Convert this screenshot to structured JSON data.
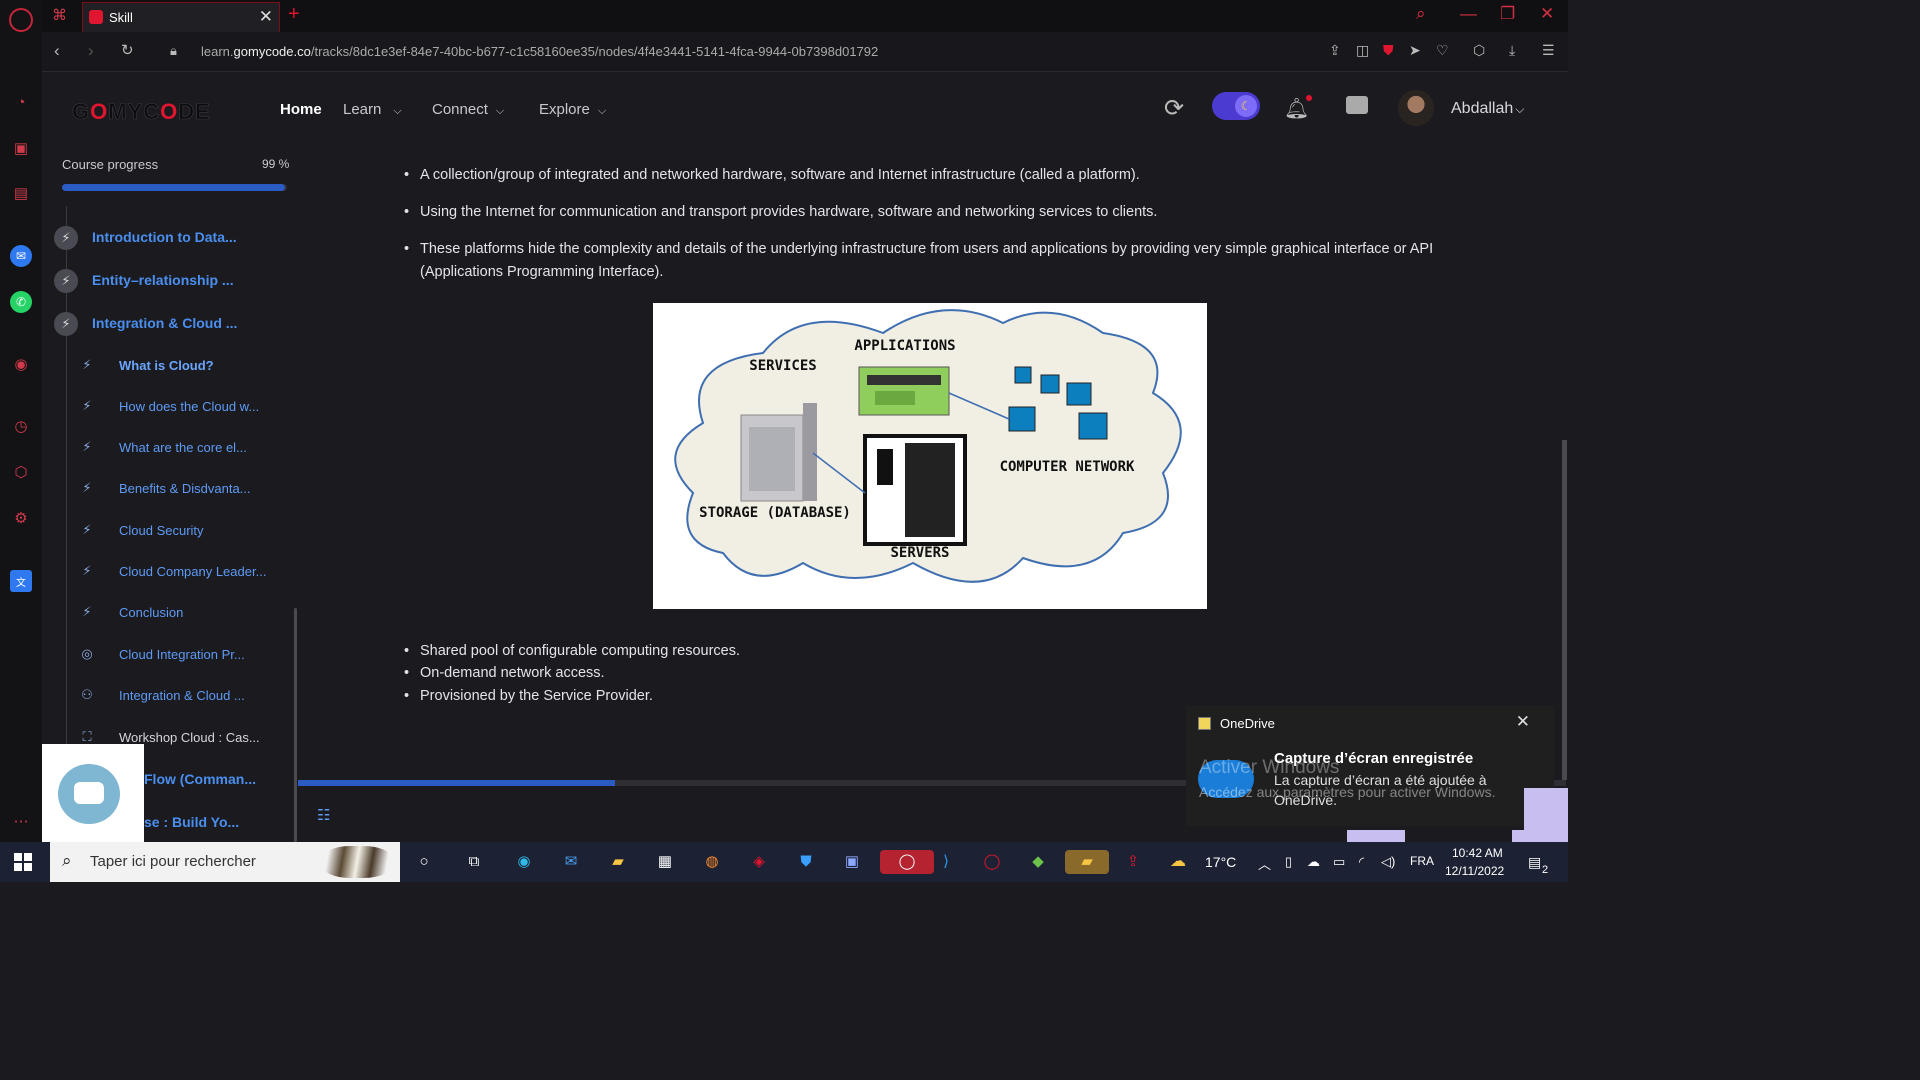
{
  "browser": {
    "tab_title": "Skill",
    "url_prefix": "learn.",
    "url_domain": "gomycode.co",
    "url_path": "/tracks/8dc1e3ef-84e7-40bc-b677-c1c58160ee35/nodes/4f4e3441-5141-4fca-9944-0b7398d01792"
  },
  "site": {
    "logo": "GOMYCODE",
    "nav": [
      {
        "label": "Home",
        "active": true
      },
      {
        "label": "Learn"
      },
      {
        "label": "Connect"
      },
      {
        "label": "Explore"
      }
    ],
    "username": "Abdallah"
  },
  "course": {
    "progress_label": "Course progress",
    "progress_value": "99 %",
    "progress_fraction": 0.99,
    "chapters": [
      {
        "label": "Introduction to Data..."
      },
      {
        "label": "Entity–relationship ..."
      },
      {
        "label": "Integration & Cloud ..."
      }
    ],
    "lessons": [
      {
        "label": "What is Cloud?",
        "icon": "bolt-icon"
      },
      {
        "label": "How does the Cloud w...",
        "icon": "bolt-icon"
      },
      {
        "label": "What are the core el...",
        "icon": "bolt-icon"
      },
      {
        "label": "Benefits & Disdvanta...",
        "icon": "bolt-icon"
      },
      {
        "label": "Cloud Security",
        "icon": "bolt-icon"
      },
      {
        "label": "Cloud Company Leader...",
        "icon": "bolt-icon"
      },
      {
        "label": "Conclusion",
        "icon": "bolt-icon"
      },
      {
        "label": "Cloud Integration Pr...",
        "icon": "target-icon"
      },
      {
        "label": "Integration & Cloud ...",
        "icon": "people-icon"
      },
      {
        "label": "Workshop Cloud : Cas...",
        "icon": "workshop-icon"
      }
    ],
    "more_chapters": [
      {
        "label": "Flow (Comman..."
      },
      {
        "label": "se : Build Yo..."
      }
    ]
  },
  "content": {
    "bullets_top": [
      "A collection/group of integrated and networked hardware, software and Internet infrastructure (called a platform).",
      "Using the Internet for communication and transport provides hardware, software and networking services to clients.",
      "These platforms hide the complexity and details of the underlying infrastructure from users and applications by providing very simple graphical interface or API (Applications Programming Interface)."
    ],
    "diagram_labels": {
      "applications": "APPLICATIONS",
      "services": "SERVICES",
      "network": "COMPUTER NETWORK",
      "storage": "STORAGE (DATABASE)",
      "servers": "SERVERS"
    },
    "bullets_bottom": [
      "Shared pool of configurable computing resources.",
      "On-demand network access.",
      "Provisioned by the Service Provider."
    ],
    "reading_progress_fraction": 0.25
  },
  "toast": {
    "app": "OneDrive",
    "title": "Capture d’écran enregistrée",
    "body": "La capture d’écran a été ajoutée à OneDrive."
  },
  "watermark": {
    "line1": "Activer Windows",
    "line2": "Accédez aux paramètres pour activer Windows."
  },
  "taskbar": {
    "search_placeholder": "Taper ici pour rechercher",
    "weather": "17°C",
    "lang": "FRA",
    "time": "10:42 AM",
    "date": "12/11/2022",
    "notifications": "2"
  }
}
